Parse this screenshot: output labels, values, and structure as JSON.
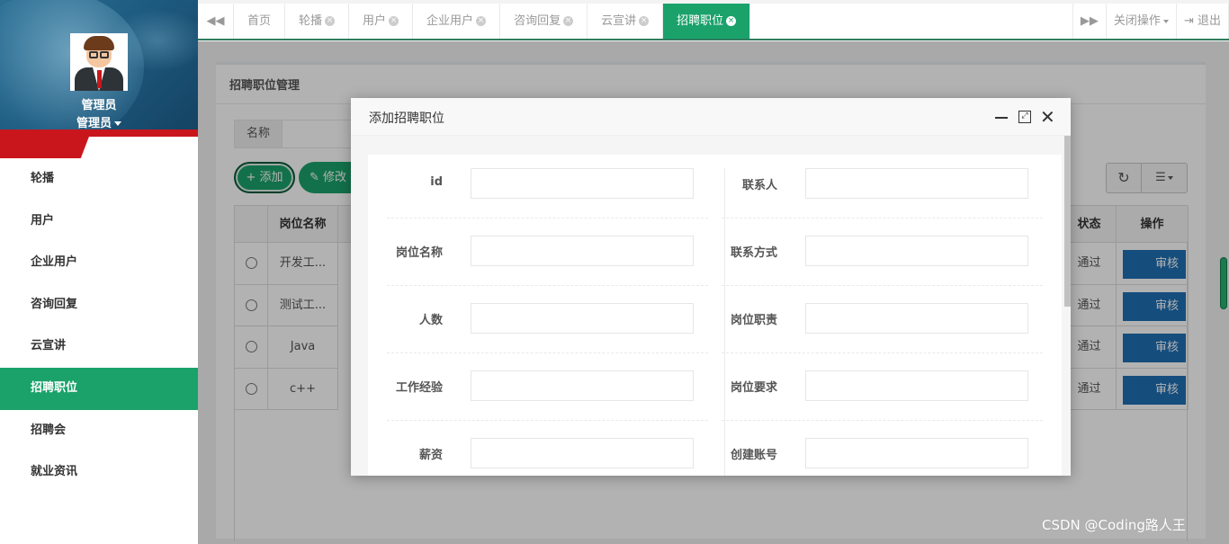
{
  "sidebar": {
    "user_name": "管理员",
    "user_role": "管理员",
    "items": [
      {
        "label": "轮播",
        "active": false
      },
      {
        "label": "用户",
        "active": false
      },
      {
        "label": "企业用户",
        "active": false
      },
      {
        "label": "咨询回复",
        "active": false
      },
      {
        "label": "云宣讲",
        "active": false
      },
      {
        "label": "招聘职位",
        "active": true
      },
      {
        "label": "招聘会",
        "active": false
      },
      {
        "label": "就业资讯",
        "active": false
      }
    ]
  },
  "tabs": {
    "items": [
      {
        "label": "首页",
        "closable": false,
        "active": false
      },
      {
        "label": "轮播",
        "closable": true,
        "active": false
      },
      {
        "label": "用户",
        "closable": true,
        "active": false
      },
      {
        "label": "企业用户",
        "closable": true,
        "active": false
      },
      {
        "label": "咨询回复",
        "closable": true,
        "active": false
      },
      {
        "label": "云宣讲",
        "closable": true,
        "active": false
      },
      {
        "label": "招聘职位",
        "closable": true,
        "active": true
      }
    ],
    "close_ops": "关闭操作",
    "logout": "退出",
    "prev_icon": "◀◀",
    "next_icon": "▶▶",
    "logout_icon": "⇥"
  },
  "panel": {
    "title": "招聘职位管理",
    "search_label": "名称",
    "add_label": "添加",
    "edit_label": "修改",
    "add_icon": "+",
    "edit_icon": "✎",
    "refresh_icon": "↻",
    "columns_icon": "☰"
  },
  "table": {
    "headers": {
      "name": "岗位名称",
      "status": "状态",
      "ops": "操作"
    },
    "rows": [
      {
        "name": "开发工...",
        "status": "通过",
        "action": "审核"
      },
      {
        "name": "测试工...",
        "status": "通过",
        "action": "审核"
      },
      {
        "name": "Java",
        "status": "通过",
        "action": "审核"
      },
      {
        "name": "c++",
        "status": "通过",
        "action": "审核"
      }
    ]
  },
  "modal": {
    "title": "添加招聘职位",
    "close_icon": "✕",
    "max_icon": "⤢",
    "left_fields": [
      "id",
      "岗位名称",
      "人数",
      "工作经验",
      "薪资"
    ],
    "right_fields": [
      "联系人",
      "联系方式",
      "岗位职责",
      "岗位要求",
      "创建账号"
    ]
  },
  "watermark": "CSDN @Coding路人王",
  "colors": {
    "accent": "#1aa26a",
    "audit": "#1f6fb4",
    "brand_red": "#c9161d"
  }
}
